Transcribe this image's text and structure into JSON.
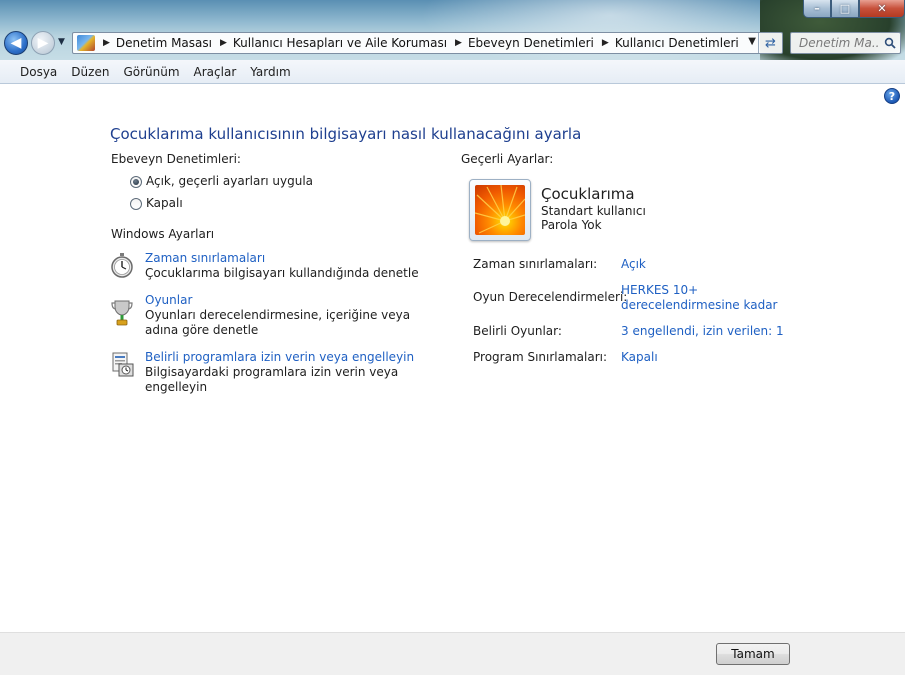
{
  "window": {
    "minimize_glyph": "–",
    "maximize_glyph": "□",
    "close_glyph": "✕"
  },
  "addressbar": {
    "crumbs": [
      "Denetim Masası",
      "Kullanıcı Hesapları ve Aile Koruması",
      "Ebeveyn Denetimleri",
      "Kullanıcı Denetimleri"
    ]
  },
  "search": {
    "placeholder": "Denetim Ma..."
  },
  "menu": {
    "items": [
      "Dosya",
      "Düzen",
      "Görünüm",
      "Araçlar",
      "Yardım"
    ]
  },
  "help": {
    "glyph": "?"
  },
  "page": {
    "title": "Çocuklarıma kullanıcısının bilgisayarı nasıl kullanacağını ayarla"
  },
  "parental_controls": {
    "label": "Ebeveyn Denetimleri:",
    "options": [
      {
        "label": "Açık, geçerli ayarları uygula",
        "checked": true
      },
      {
        "label": "Kapalı",
        "checked": false
      }
    ]
  },
  "windows_settings": {
    "label": "Windows Ayarları",
    "items": [
      {
        "icon": "stopwatch-icon",
        "link": "Zaman sınırlamaları",
        "description": "Çocuklarıma bilgisayarı kullandığında denetle"
      },
      {
        "icon": "trophy-icon",
        "link": "Oyunlar",
        "description": "Oyunları derecelendirmesine, içeriğine veya adına göre denetle"
      },
      {
        "icon": "program-restrictions-icon",
        "link": "Belirli programlara izin verin veya engelleyin",
        "description": "Bilgisayardaki programlara izin verin veya engelleyin"
      }
    ]
  },
  "current_settings": {
    "label": "Geçerli Ayarlar:",
    "user": {
      "name": "Çocuklarıma",
      "account_type": "Standart kullanıcı",
      "password": "Parola Yok"
    },
    "rows": [
      {
        "key": "Zaman sınırlamaları:",
        "value": "Açık"
      },
      {
        "key": "Oyun Derecelendirmeleri:",
        "value_line1": "HERKES 10+",
        "value_line2": "derecelendirmesine kadar"
      },
      {
        "key": "Belirli Oyunlar:",
        "value": "3 engellendi, izin verilen: 1"
      },
      {
        "key": "Program Sınırlamaları:",
        "value": "Kapalı"
      }
    ]
  },
  "footer": {
    "ok_label": "Tamam"
  },
  "colors": {
    "link": "#1f60c3",
    "title": "#1e3f8f",
    "footer_bg": "#f0f0f0"
  }
}
